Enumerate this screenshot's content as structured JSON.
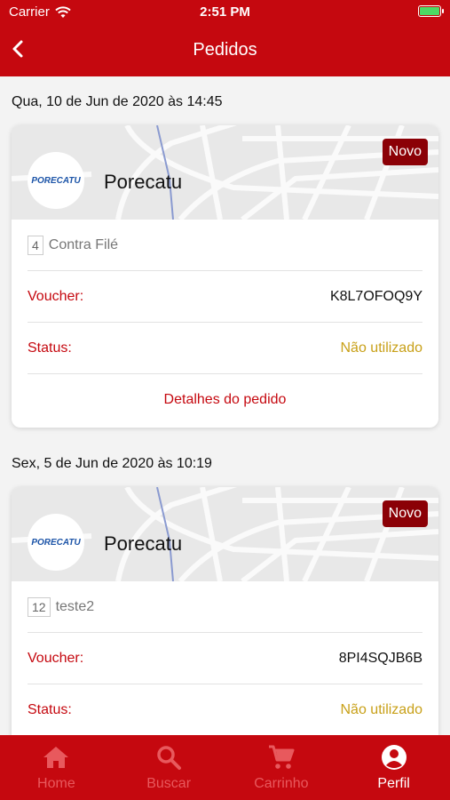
{
  "status_bar": {
    "carrier": "Carrier",
    "time": "2:51 PM",
    "battery_color": "#4cd964"
  },
  "nav": {
    "title": "Pedidos",
    "back_icon": "chevron-left-icon"
  },
  "orders": [
    {
      "date": "Qua, 10 de Jun de 2020 às 14:45",
      "store": "Porecatu",
      "logo_text": "PORECATU",
      "badge": "Novo",
      "item_qty": "4",
      "item_name": "Contra Filé",
      "voucher_label": "Voucher:",
      "voucher": "K8L7OFOQ9Y",
      "status_label": "Status:",
      "status": "Não utilizado",
      "details_label": "Detalhes do pedido"
    },
    {
      "date": "Sex, 5 de Jun de 2020 às 10:19",
      "store": "Porecatu",
      "logo_text": "PORECATU",
      "badge": "Novo",
      "item_qty": "12",
      "item_name": "teste2",
      "voucher_label": "Voucher:",
      "voucher": "8PI4SQJB6B",
      "status_label": "Status:",
      "status": "Não utilizado"
    }
  ],
  "tabs": [
    {
      "label": "Home",
      "icon": "home-icon",
      "active": false
    },
    {
      "label": "Buscar",
      "icon": "search-icon",
      "active": false
    },
    {
      "label": "Carrinho",
      "icon": "cart-icon",
      "active": false
    },
    {
      "label": "Perfil",
      "icon": "profile-icon",
      "active": true
    }
  ],
  "colors": {
    "brand": "#c5080f",
    "badge": "#8b0006",
    "status": "#c8a018",
    "inactive_tab": "#e8595d"
  }
}
